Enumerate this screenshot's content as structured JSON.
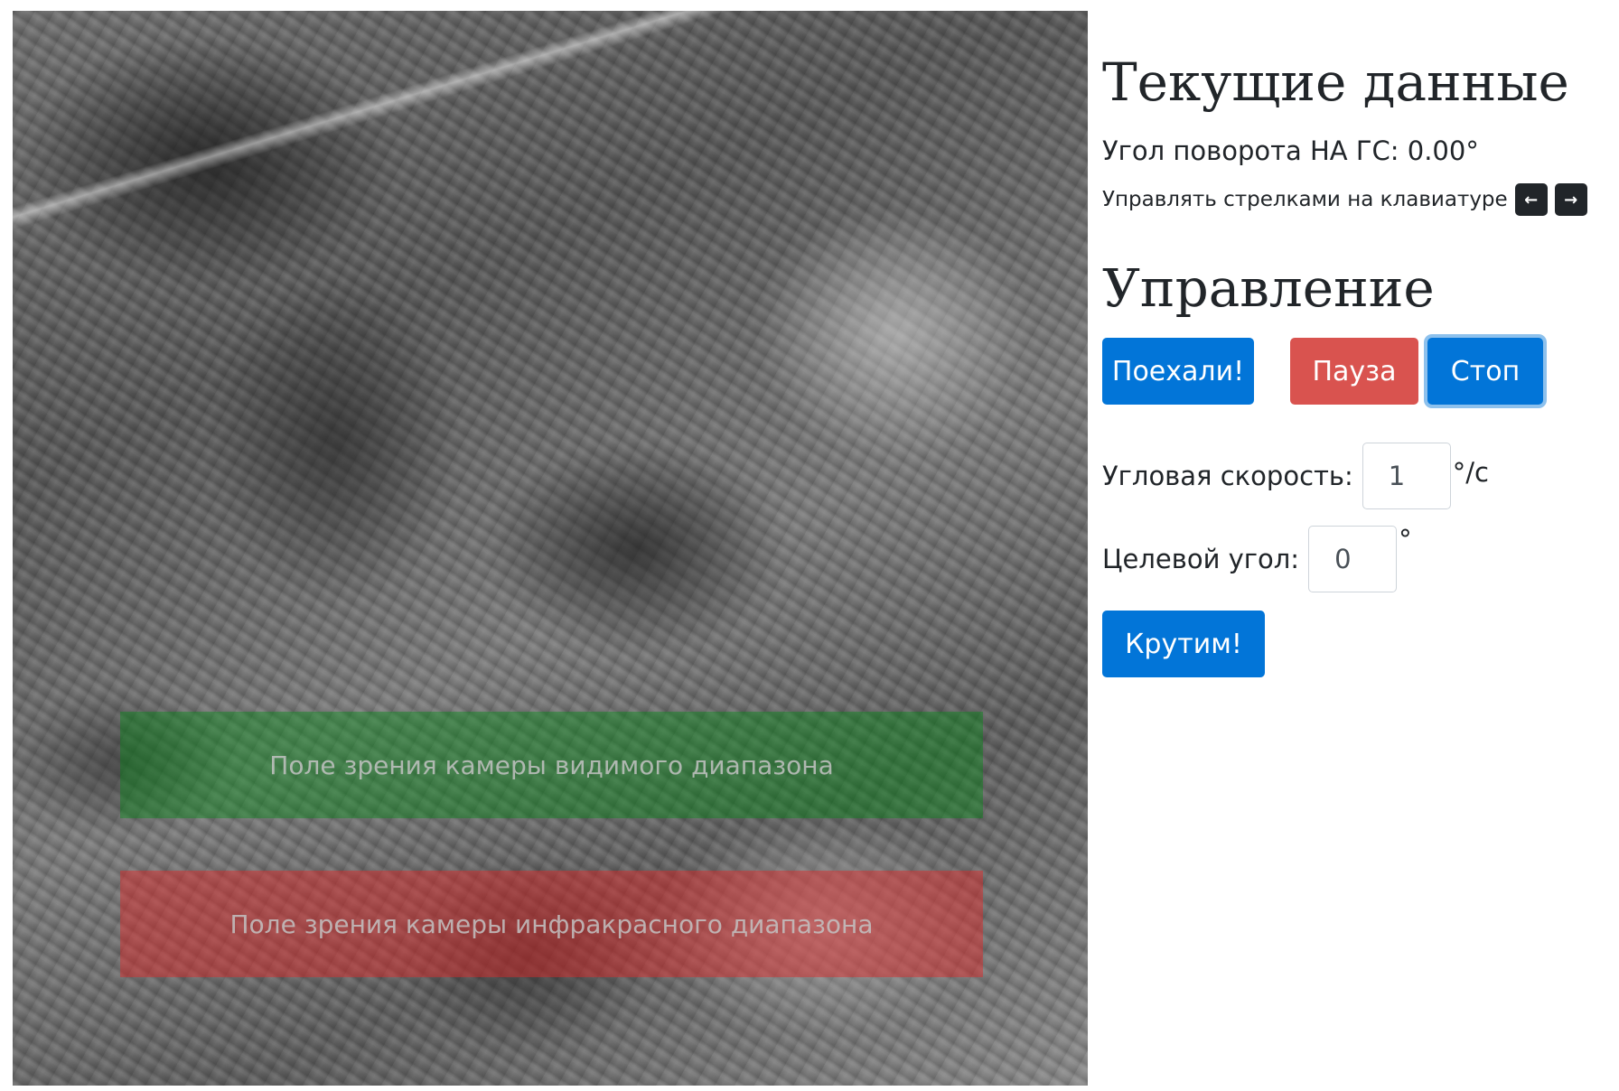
{
  "map": {
    "fov_visible_label": "Поле зрения камеры видимого диапазона",
    "fov_infrared_label": "Поле зрения камеры инфракрасного диапазона"
  },
  "current": {
    "title": "Текущие данные",
    "angle_text": "Угол поворота НА ГС: 0.00°",
    "hint_text": "Управлять стрелками на клавиатуре",
    "key_left": "←",
    "key_right": "→"
  },
  "control": {
    "title": "Управление",
    "go_label": "Поехали!",
    "pause_label": "Пауза",
    "stop_label": "Стоп",
    "speed_label": "Угловая скорость:",
    "speed_value": "1",
    "speed_unit": "°/с",
    "target_label": "Целевой угол:",
    "target_value": "0",
    "target_unit": "°",
    "spin_label": "Крутим!"
  },
  "colors": {
    "primary": "#0275d8",
    "danger": "#d9534f",
    "fov_visible": "#008c14",
    "fov_infrared": "#e12828"
  }
}
